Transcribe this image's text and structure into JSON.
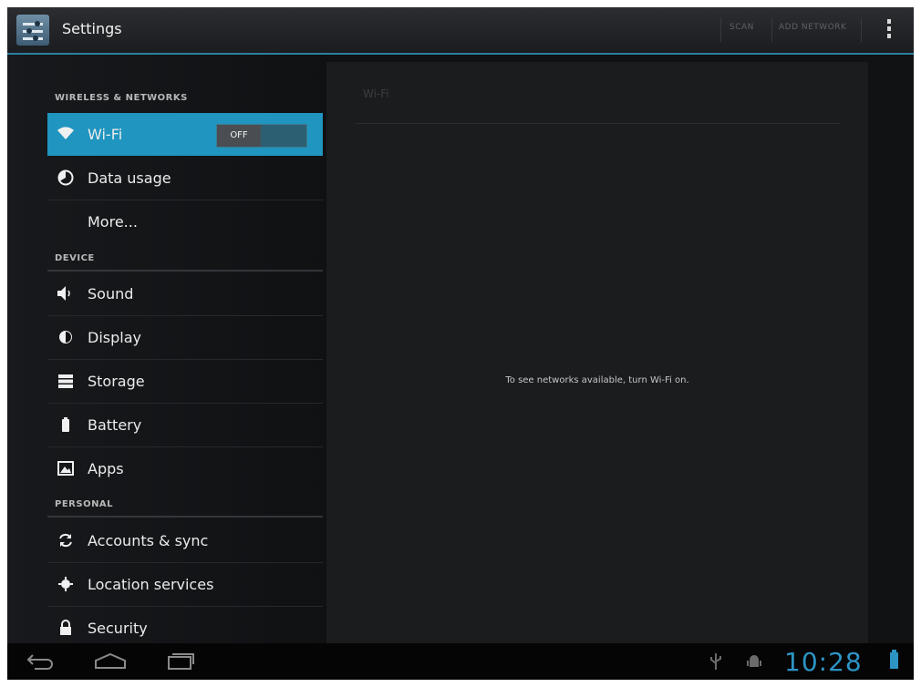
{
  "app": {
    "title": "Settings"
  },
  "actionbar": {
    "scan_label": "SCAN",
    "add_network_label": "ADD NETWORK"
  },
  "sections": [
    {
      "header": "WIRELESS & NETWORKS"
    },
    {
      "header": "DEVICE"
    },
    {
      "header": "PERSONAL"
    }
  ],
  "items": [
    {
      "label": "Wi-Fi",
      "icon": "wifi-icon",
      "toggle": "OFF",
      "selected": true
    },
    {
      "label": "Data usage",
      "icon": "data-usage-icon"
    },
    {
      "label": "More...",
      "icon": ""
    },
    {
      "label": "Sound",
      "icon": "speaker-icon"
    },
    {
      "label": "Display",
      "icon": "brightness-icon"
    },
    {
      "label": "Storage",
      "icon": "storage-icon"
    },
    {
      "label": "Battery",
      "icon": "battery-icon"
    },
    {
      "label": "Apps",
      "icon": "apps-icon"
    },
    {
      "label": "Accounts & sync",
      "icon": "sync-icon"
    },
    {
      "label": "Location services",
      "icon": "location-icon"
    },
    {
      "label": "Security",
      "icon": "lock-icon"
    }
  ],
  "detail": {
    "title": "Wi-Fi",
    "message": "To see networks available, turn Wi-Fi on."
  },
  "statusbar": {
    "time": "10:28"
  },
  "colors": {
    "accent": "#1f95bf",
    "clock": "#2d94c4"
  }
}
